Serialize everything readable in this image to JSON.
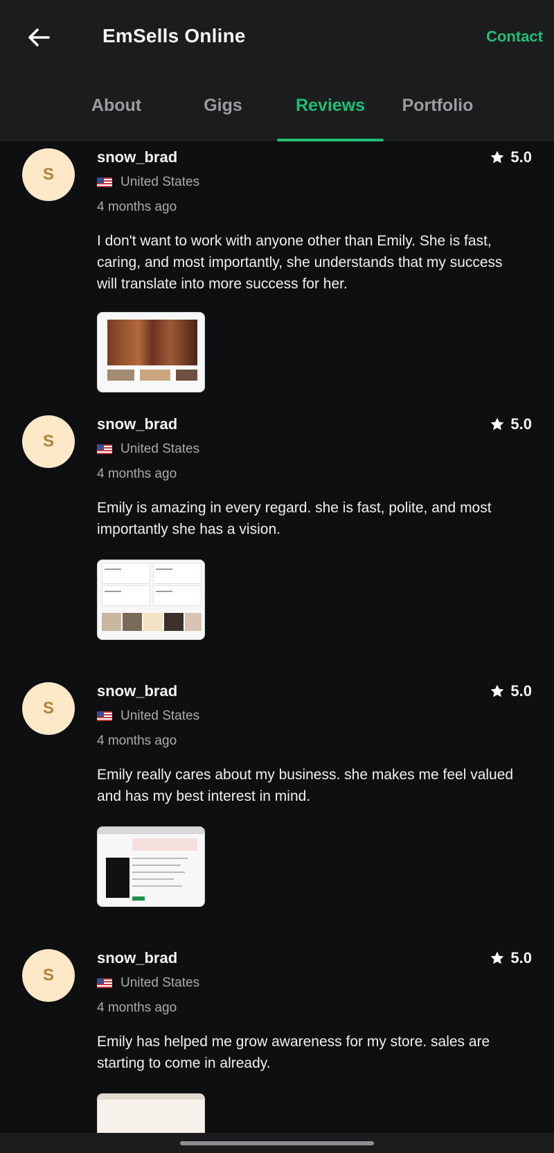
{
  "header": {
    "title": "EmSells Online",
    "contact_label": "Contact",
    "back_icon": "arrow-left-icon"
  },
  "tabs": [
    {
      "label": "About",
      "active": false
    },
    {
      "label": "Gigs",
      "active": false
    },
    {
      "label": "Reviews",
      "active": true
    },
    {
      "label": "Portfolio",
      "active": false
    }
  ],
  "colors": {
    "accent": "#1dbf73",
    "background": "#0e0f10",
    "header_background": "#1b1c1e",
    "avatar_background": "#fde8c8",
    "avatar_text": "#b08238"
  },
  "reviews": [
    {
      "initial": "S",
      "username": "snow_brad",
      "rating": "5.0",
      "country": "United States",
      "time_ago": "4 months ago",
      "text": "I don't want to work with anyone other than Emily. She is fast, caring, and most importantly, she understands that my success will translate into more success for her."
    },
    {
      "initial": "S",
      "username": "snow_brad",
      "rating": "5.0",
      "country": "United States",
      "time_ago": "4 months ago",
      "text": "Emily is amazing in every regard. she is fast, polite, and most importantly she has a vision."
    },
    {
      "initial": "S",
      "username": "snow_brad",
      "rating": "5.0",
      "country": "United States",
      "time_ago": "4 months ago",
      "text": "Emily really cares about my business. she makes me feel valued and has my best interest in mind."
    },
    {
      "initial": "S",
      "username": "snow_brad",
      "rating": "5.0",
      "country": "United States",
      "time_ago": "4 months ago",
      "text": "Emily has helped me grow awareness for my store. sales are starting to come in already."
    }
  ]
}
